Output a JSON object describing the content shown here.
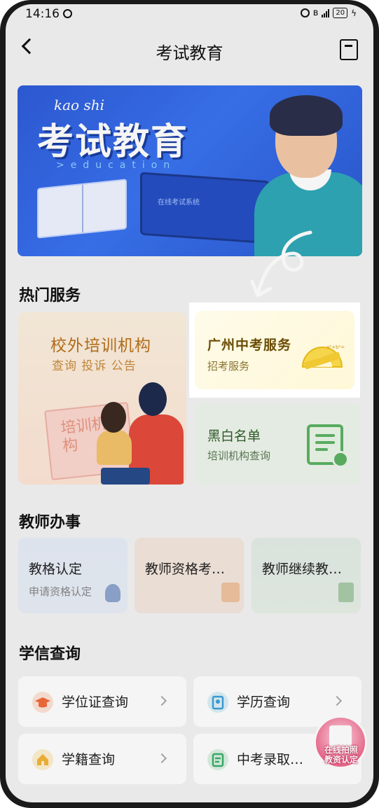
{
  "status_bar": {
    "time": "14:16",
    "battery": "20",
    "network": "4G"
  },
  "header": {
    "title": "考试教育",
    "back_icon": "chevron-left-icon",
    "action_icon": "bookmark-icon"
  },
  "banner": {
    "pinyin": "kao  shi",
    "title": "考试教育",
    "subtitle": ">education",
    "screen_text": "在线考试系统"
  },
  "hot_services": {
    "title": "热门服务",
    "main_card": {
      "title": "校外培训机构",
      "subtitle": "查询 投诉 公告",
      "sign_text": "培训机构"
    },
    "highlight_card": {
      "title": "广州中考服务",
      "subtitle": "招考服务",
      "icon": "ruler-icon"
    },
    "small_card": {
      "title": "黑白名单",
      "subtitle": "培训机构查询",
      "icon": "list-certificate-icon"
    }
  },
  "teacher": {
    "title": "教师办事",
    "cards": [
      {
        "title": "教格认定",
        "subtitle": "申请资格认定"
      },
      {
        "title": "教师资格考…",
        "subtitle": ""
      },
      {
        "title": "教师继续教…",
        "subtitle": ""
      }
    ]
  },
  "query": {
    "title": "学信查询",
    "items": [
      {
        "label": "学位证查询",
        "icon": "graduation-cap-icon",
        "color": "#f26b3a"
      },
      {
        "label": "学历查询",
        "icon": "certificate-icon",
        "color": "#3aa0d8"
      },
      {
        "label": "学籍查询",
        "icon": "house-icon",
        "color": "#f2b43a"
      },
      {
        "label": "中考录取…",
        "icon": "document-icon",
        "color": "#3cae6a"
      }
    ]
  },
  "float_badge": {
    "text": "在线拍照\n教资认定"
  },
  "colors": {
    "banner_blue": "#2e5bd8",
    "main_card_text": "#b8701a",
    "highlight_text": "#6b4c05",
    "green": "#5cb262"
  }
}
